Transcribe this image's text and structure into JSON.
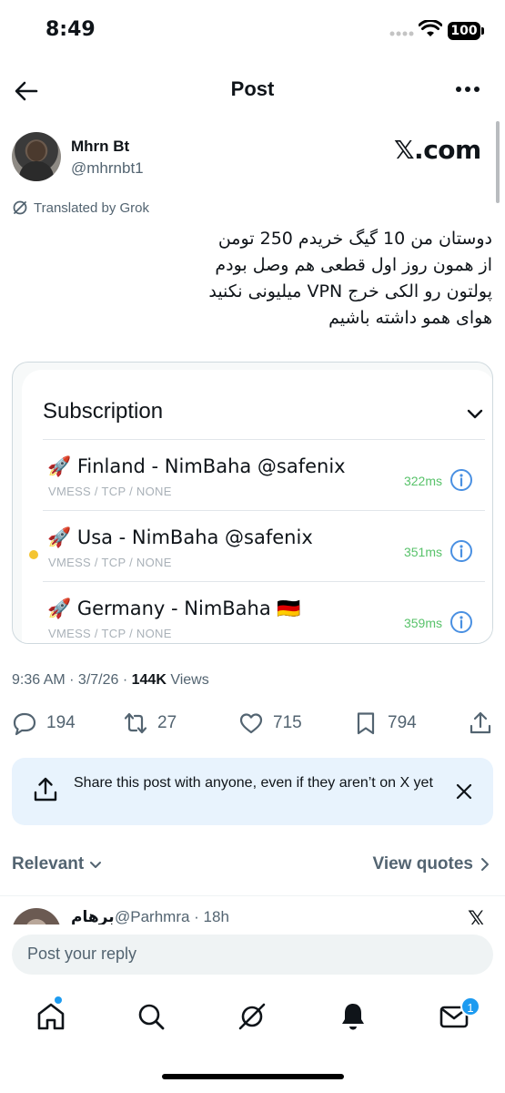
{
  "status_bar": {
    "time": "8:49",
    "battery": "100"
  },
  "header": {
    "title": "Post"
  },
  "post": {
    "author_name": "Mhrn Bt",
    "author_handle": "@mhrnbt1",
    "watermark": "𝕏.com",
    "translated_label": "Translated by Grok",
    "lines": [
      "دوستان من 10 گیگ خریدم 250 تومن",
      "از همون روز اول قطعی هم وصل بودم",
      "پولتون رو الکی خرج VPN  میلیونی نکنید",
      "هوای همو داشته باشیم"
    ],
    "time": "9:36 AM · 3/7/26 · ",
    "views_count": "144K",
    "views_label": " Views"
  },
  "subscription": {
    "title": "Subscription",
    "servers": [
      {
        "name": "🚀 Finland - NimBaha @safenix",
        "meta": "VMESS / TCP / NONE",
        "ping": "322ms",
        "active": false
      },
      {
        "name": "🚀 Usa - NimBaha  @safenix",
        "meta": "VMESS / TCP / NONE",
        "ping": "351ms",
        "active": true
      },
      {
        "name": "🚀 Germany - NimBaha 🇩🇪",
        "meta": "VMESS / TCP / NONE",
        "ping": "359ms",
        "active": false
      }
    ],
    "ping_color": "#58c26a",
    "active_dot_color": "#f4c430"
  },
  "actions": {
    "replies": "194",
    "reposts": "27",
    "likes": "715",
    "bookmarks": "794"
  },
  "share_banner": {
    "text": "Share this post with anyone, even if they aren’t on X yet"
  },
  "sort": {
    "relevant": "Relevant",
    "view_quotes": "View quotes"
  },
  "reply_preview": {
    "name": "برهام",
    "handle": "@Parhmra · 18h",
    "x_mark": "𝕏"
  },
  "reply_box": {
    "placeholder": "Post your reply"
  },
  "nav": {
    "messages_badge": "1"
  },
  "colors": {
    "accent": "#1d9bf0",
    "secondary_text": "#536471",
    "banner_bg": "#e8f3fd"
  }
}
